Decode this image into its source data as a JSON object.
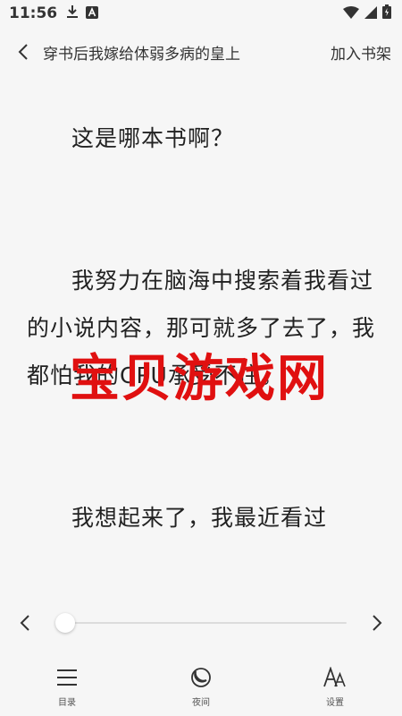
{
  "status_bar": {
    "time": "11:56",
    "left_icons": [
      "download-icon",
      "a-icon"
    ],
    "right_icons": [
      "wifi-icon",
      "signal-icon",
      "battery-icon"
    ]
  },
  "header": {
    "book_title": "穿书后我嫁给体弱多病的皇上",
    "add_to_shelf": "加入书架"
  },
  "content": {
    "paragraphs": [
      "这是哪本书啊？",
      "我努力在脑海中搜索着我看过的小说内容，那可就多了去了，我都怕我的CPU承受不住。",
      "我想起来了，我最近看过"
    ]
  },
  "watermark": {
    "text": "宝贝游戏网",
    "color": "#e01010"
  },
  "progress": {
    "value_percent": 0
  },
  "bottom_nav": {
    "items": [
      {
        "label": "目录",
        "icon": "menu-icon"
      },
      {
        "label": "夜间",
        "icon": "moon-icon"
      },
      {
        "label": "设置",
        "icon": "font-settings-icon"
      }
    ]
  }
}
